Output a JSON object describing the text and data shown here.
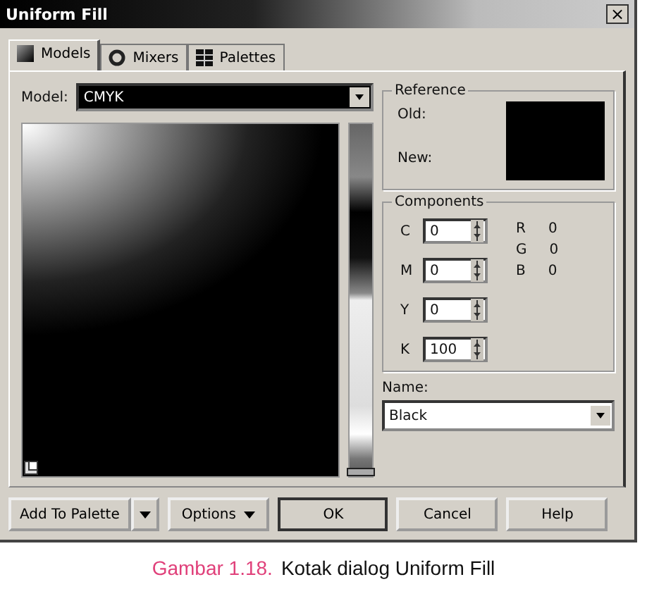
{
  "window": {
    "title": "Uniform Fill",
    "close": "×"
  },
  "tabs": [
    {
      "label": "Models",
      "kind": "models",
      "selected": true
    },
    {
      "label": "Mixers",
      "kind": "mixers",
      "selected": false
    },
    {
      "label": "Palettes",
      "kind": "palettes",
      "selected": false
    }
  ],
  "model": {
    "label": "Model:",
    "value": "CMYK"
  },
  "hue_slider": {
    "level": 0
  },
  "reference": {
    "title": "Reference",
    "old": "Old:",
    "new": "New:"
  },
  "components": {
    "title": "Components",
    "fields": [
      {
        "label": "C",
        "value": "0"
      },
      {
        "label": "M",
        "value": "0"
      },
      {
        "label": "Y",
        "value": "0"
      },
      {
        "label": "K",
        "value": "100"
      }
    ],
    "readouts": [
      {
        "label": "R",
        "value": "0"
      },
      {
        "label": "G",
        "value": "0"
      },
      {
        "label": "B",
        "value": "0"
      }
    ]
  },
  "name": {
    "label": "Name:",
    "value": "Black"
  },
  "buttons": [
    {
      "label": "Add To Palette",
      "kind": "split"
    },
    {
      "label": "Options",
      "kind": "menu"
    },
    {
      "label": "OK",
      "kind": "default"
    },
    {
      "label": "Cancel",
      "kind": "plain"
    },
    {
      "label": "Help",
      "kind": "plain"
    }
  ],
  "caption": {
    "number": "Gambar 1.18.",
    "text": "Kotak dialog Uniform Fill"
  }
}
